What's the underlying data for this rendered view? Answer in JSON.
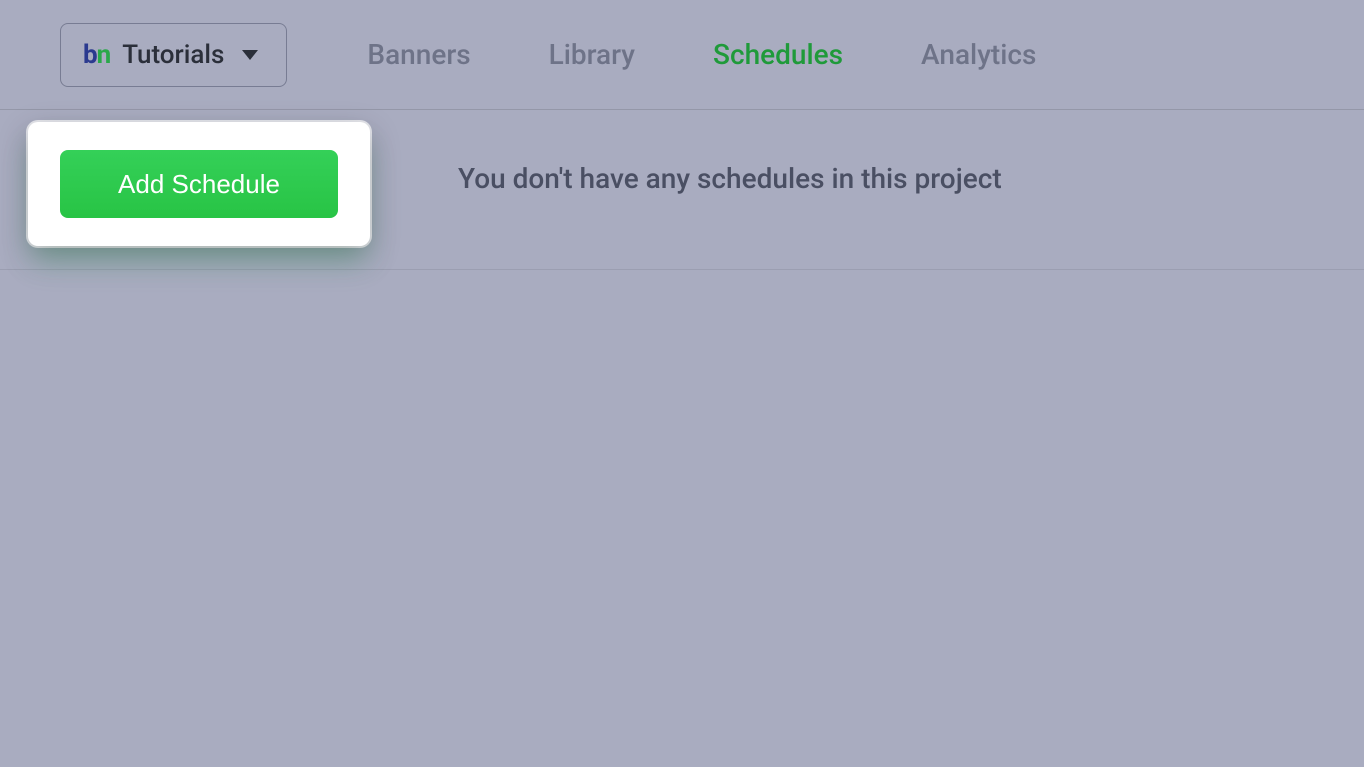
{
  "header": {
    "logo_b": "b",
    "logo_n": "n",
    "project_name": "Tutorials"
  },
  "nav": {
    "items": [
      {
        "label": "Banners",
        "active": false
      },
      {
        "label": "Library",
        "active": false
      },
      {
        "label": "Schedules",
        "active": true
      },
      {
        "label": "Analytics",
        "active": false
      }
    ]
  },
  "main": {
    "add_schedule_label": "Add Schedule",
    "empty_message": "You don't have any schedules in this project"
  }
}
